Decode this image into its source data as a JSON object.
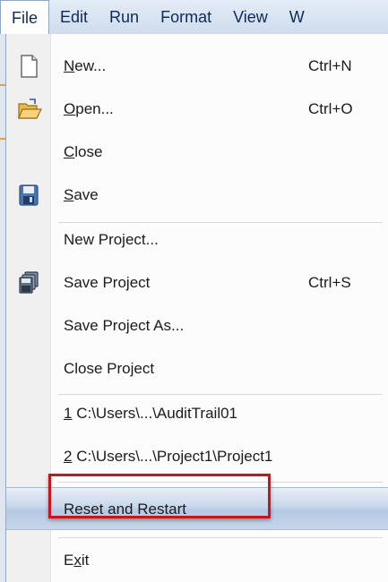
{
  "menubar": {
    "items": [
      {
        "label": "File"
      },
      {
        "label": "Edit"
      },
      {
        "label": "Run"
      },
      {
        "label": "Format"
      },
      {
        "label": "View"
      },
      {
        "label": "W"
      }
    ]
  },
  "file_menu": {
    "new": {
      "mnemonic": "N",
      "rest": "ew...",
      "shortcut": "Ctrl+N",
      "icon": "new-document-icon"
    },
    "open": {
      "mnemonic": "O",
      "rest": "pen...",
      "shortcut": "Ctrl+O",
      "icon": "open-folder-icon"
    },
    "close": {
      "mnemonic": "C",
      "rest": "lose"
    },
    "save": {
      "mnemonic": "S",
      "rest": "ave",
      "icon": "floppy-disk-icon"
    },
    "new_project": {
      "label": "New Project..."
    },
    "save_project": {
      "label": "Save Project",
      "shortcut": "Ctrl+S",
      "icon": "save-project-icon"
    },
    "save_project_as": {
      "label": "Save Project As..."
    },
    "close_project": {
      "label": "Close Project"
    },
    "recent1": {
      "mnemonic": "1",
      "rest": " C:\\Users\\...\\AuditTrail01"
    },
    "recent2": {
      "mnemonic": "2",
      "rest": " C:\\Users\\...\\Project1\\Project1"
    },
    "reset_restart": {
      "label": "Reset and Restart"
    },
    "exit": {
      "pre": "E",
      "mnemonic": "x",
      "rest": "it"
    }
  },
  "colors": {
    "highlight_border": "#c4161c",
    "menubar_bg": "#cfdcee"
  }
}
